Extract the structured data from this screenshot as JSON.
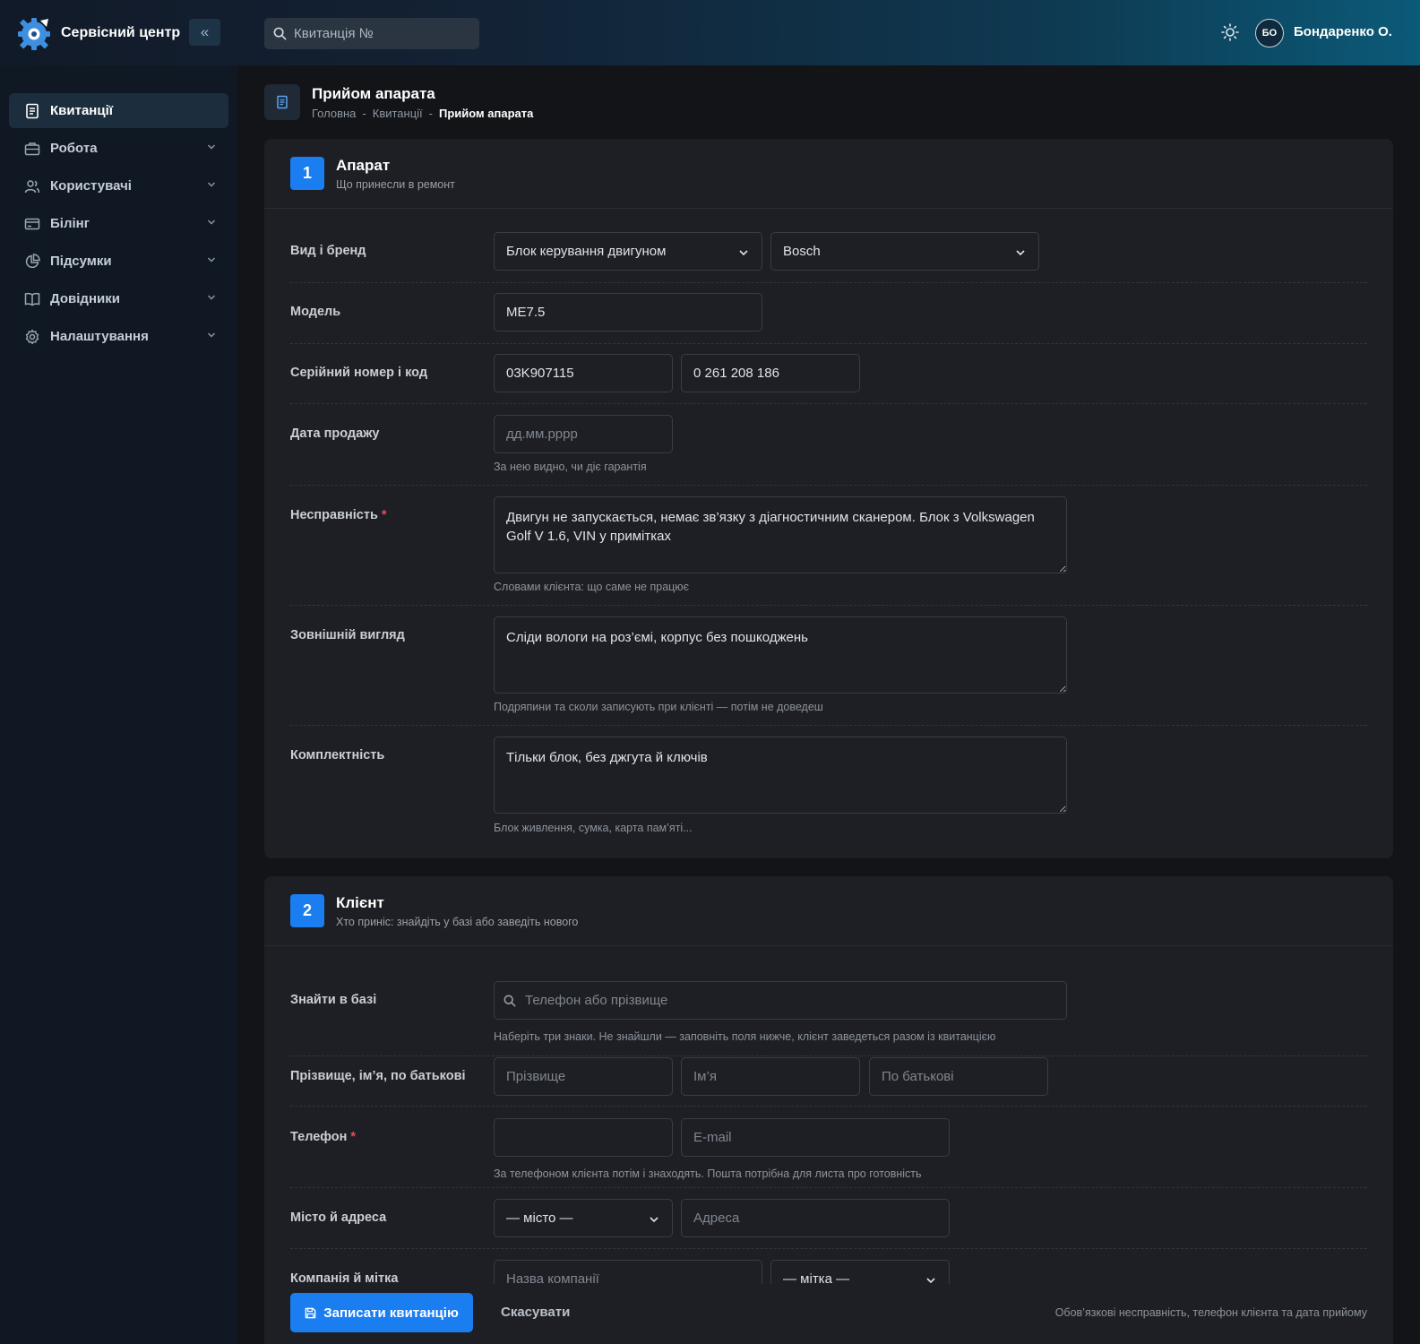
{
  "app": {
    "title": "Сервісний центр",
    "collapse_icon": "«"
  },
  "header": {
    "search_placeholder": "Квитанція №",
    "avatar_initials": "БО",
    "user_name": "Бондаренко О."
  },
  "sidebar": {
    "items": [
      {
        "label": "Квитанції",
        "icon": "receipt-icon"
      },
      {
        "label": "Робота",
        "icon": "briefcase-icon"
      },
      {
        "label": "Користувачі",
        "icon": "users-icon"
      },
      {
        "label": "Білінг",
        "icon": "credit-card-icon"
      },
      {
        "label": "Підсумки",
        "icon": "pie-chart-icon"
      },
      {
        "label": "Довідники",
        "icon": "book-icon"
      },
      {
        "label": "Налаштування",
        "icon": "gear-icon"
      }
    ]
  },
  "page": {
    "title": "Прийом апарата",
    "breadcrumb": [
      "Головна",
      "Квитанції",
      "Прийом апарата"
    ],
    "breadcrumb_sep": "-"
  },
  "device": {
    "step": "1",
    "title": "Апарат",
    "subtitle": "Що принесли в ремонт",
    "type_brand_label": "Вид і бренд",
    "type_value": "Блок керування двигуном",
    "brand_value": "Bosch",
    "model_label": "Модель",
    "model_value": "ME7.5",
    "serial_label": "Серійний номер і код",
    "serial_value": "03K907115",
    "code_value": "0 261 208 186",
    "sale_date_label": "Дата продажу",
    "sale_date_placeholder": "дд.мм.рррр",
    "sale_date_hint": "За нею видно, чи діє гарантія",
    "fault_label": "Несправність",
    "required_mark": "*",
    "fault_value": "Двигун не запускається, немає зв’язку з діагностичним сканером. Блок з Volkswagen Golf V 1.6, VIN у примітках",
    "fault_hint": "Словами клієнта: що саме не працює",
    "appearance_label": "Зовнішній вигляд",
    "appearance_value": "Сліди вологи на роз’ємі, корпус без пошкоджень",
    "appearance_hint": "Подряпини та сколи записують при клієнті — потім не доведеш",
    "kit_label": "Комплектність",
    "kit_value": "Тільки блок, без джгута й ключів",
    "kit_hint": "Блок живлення, сумка, карта пам’яті..."
  },
  "client": {
    "step": "2",
    "title": "Клієнт",
    "subtitle": "Хто приніс: знайдіть у базі або заведіть нового",
    "find_label": "Знайти в базі",
    "find_placeholder": "Телефон або прізвище",
    "find_hint": "Наберіть три знаки. Не знайшли — заповніть поля нижче, клієнт заведеться разом із квитанцією",
    "name_label": "Прізвище, ім’я, по батькові",
    "surname_placeholder": "Прізвище",
    "firstname_placeholder": "Ім’я",
    "patronymic_placeholder": "По батькові",
    "phone_label": "Телефон",
    "required_mark": "*",
    "phone_value": "",
    "email_placeholder": "E-mail",
    "phone_hint": "За телефоном клієнта потім і знаходять. Пошта потрібна для листа про готовність",
    "city_address_label": "Місто й адреса",
    "city_value": "— місто —",
    "address_placeholder": "Адреса",
    "company_tag_label": "Компанія й мітка",
    "company_placeholder": "Назва компанії",
    "tag_value": "— мітка —"
  },
  "footer": {
    "save_label": "Записати квитанцію",
    "cancel_label": "Скасувати",
    "note": "Обов’язкові несправність, телефон клієнта та дата прийому"
  },
  "colors": {
    "accent": "#1a7ef0",
    "required": "#ea4b5c"
  }
}
